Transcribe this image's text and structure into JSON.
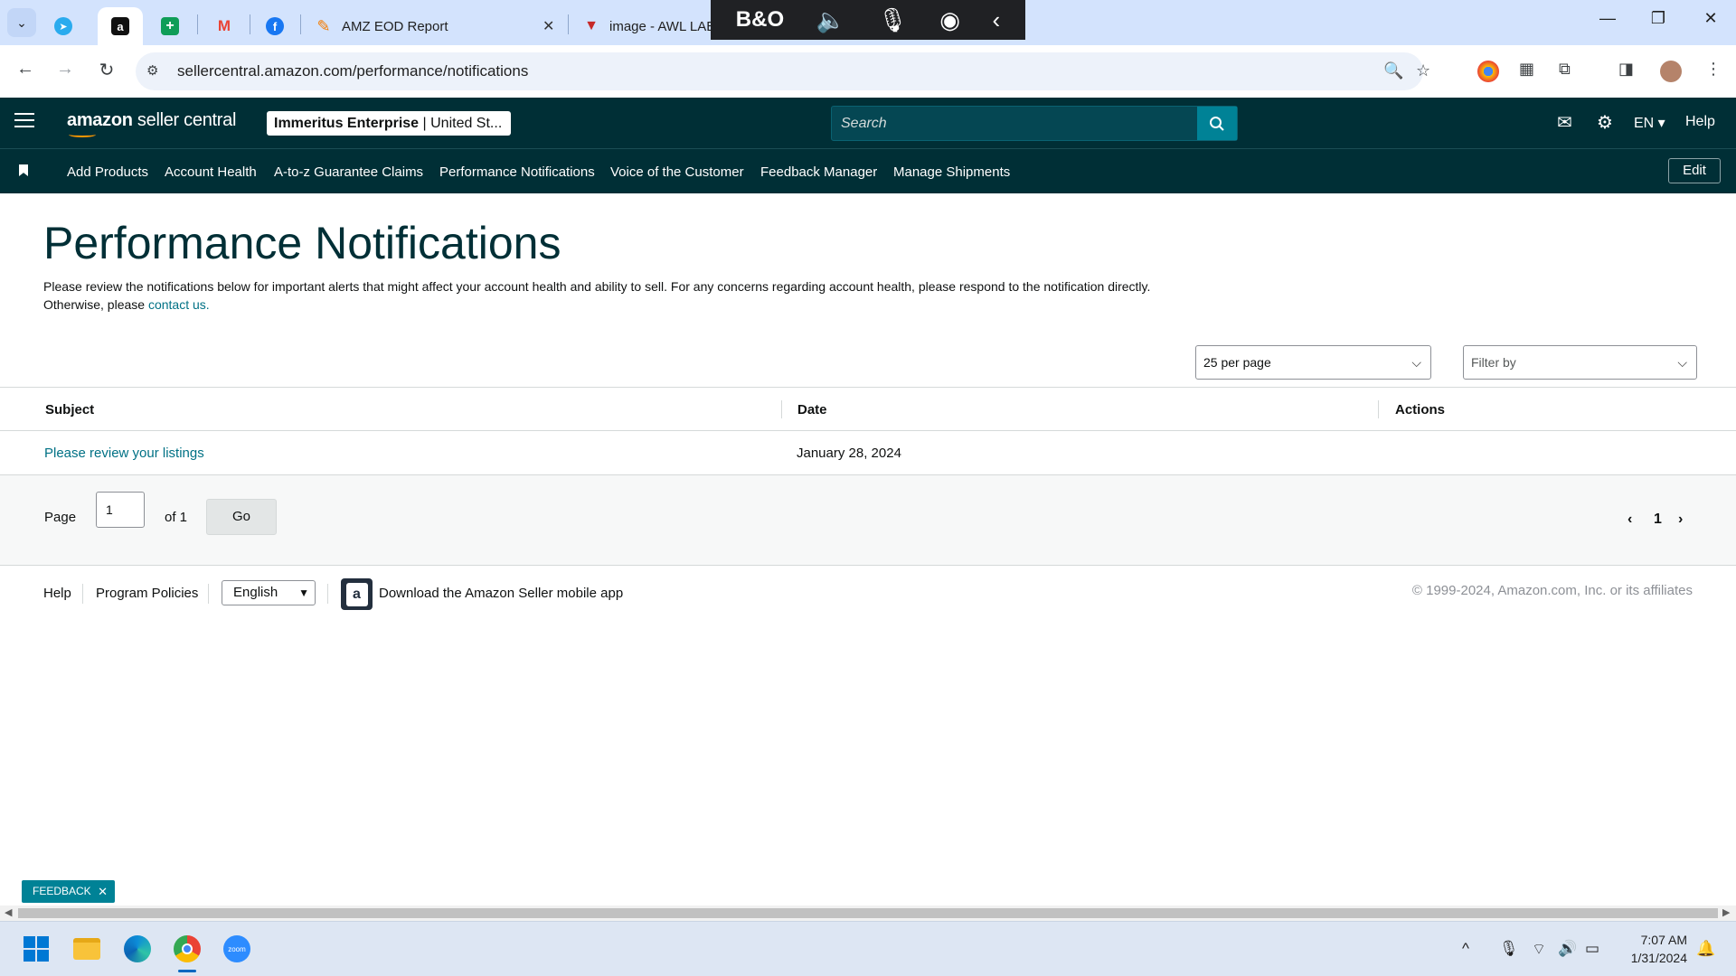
{
  "browser": {
    "tabs": [
      {
        "label": "",
        "favicon": "telegram-icon"
      },
      {
        "label": "",
        "favicon": "amazon-icon",
        "active": true
      },
      {
        "label": "",
        "favicon": "sheets-icon"
      },
      {
        "label": "",
        "favicon": "gmail-icon"
      },
      {
        "label": "",
        "favicon": "facebook-icon"
      },
      {
        "label": "AMZ EOD Report",
        "favicon": "report-icon"
      },
      {
        "label": "image - AWL LAB",
        "favicon": "awl-icon"
      }
    ],
    "url": "sellercentral.amazon.com/performance/notifications"
  },
  "header": {
    "logo_bold": "amazon",
    "logo_rest": " seller central",
    "store_name": "Immeritus Enterprise",
    "store_region": " | United St...",
    "search_placeholder": "Search",
    "language": "EN",
    "help": "Help"
  },
  "nav": {
    "items": [
      "Add Products",
      "Account Health",
      "A-to-z Guarantee Claims",
      "Performance Notifications",
      "Voice of the Customer",
      "Feedback Manager",
      "Manage Shipments"
    ],
    "edit": "Edit"
  },
  "page": {
    "title": "Performance Notifications",
    "intro": "Please review the notifications below for important alerts that might affect your account health and ability to sell. For any concerns regarding account health, please respond to the notification directly. Otherwise, please ",
    "contact_link": "contact us.",
    "per_page": "25 per page",
    "filter_placeholder": "Filter by"
  },
  "table": {
    "headers": {
      "subject": "Subject",
      "date": "Date",
      "actions": "Actions"
    },
    "rows": [
      {
        "subject": "Please review your listings",
        "date": "January 28, 2024",
        "actions": ""
      }
    ]
  },
  "pagination": {
    "page_label": "Page",
    "current": "1",
    "of_label": "of 1",
    "go": "Go",
    "page_number": "1"
  },
  "footer": {
    "help": "Help",
    "policies": "Program Policies",
    "language": "English",
    "app_download": "Download the Amazon Seller mobile app",
    "copyright": "© 1999-2024, Amazon.com, Inc. or its affiliates"
  },
  "feedback": {
    "label": "FEEDBACK"
  },
  "taskbar": {
    "time": "7:07 AM",
    "date": "1/31/2024"
  },
  "colors": {
    "header_bg": "#002f36",
    "accent": "#008296",
    "link": "#007185",
    "brand_orange": "#ff9900"
  }
}
